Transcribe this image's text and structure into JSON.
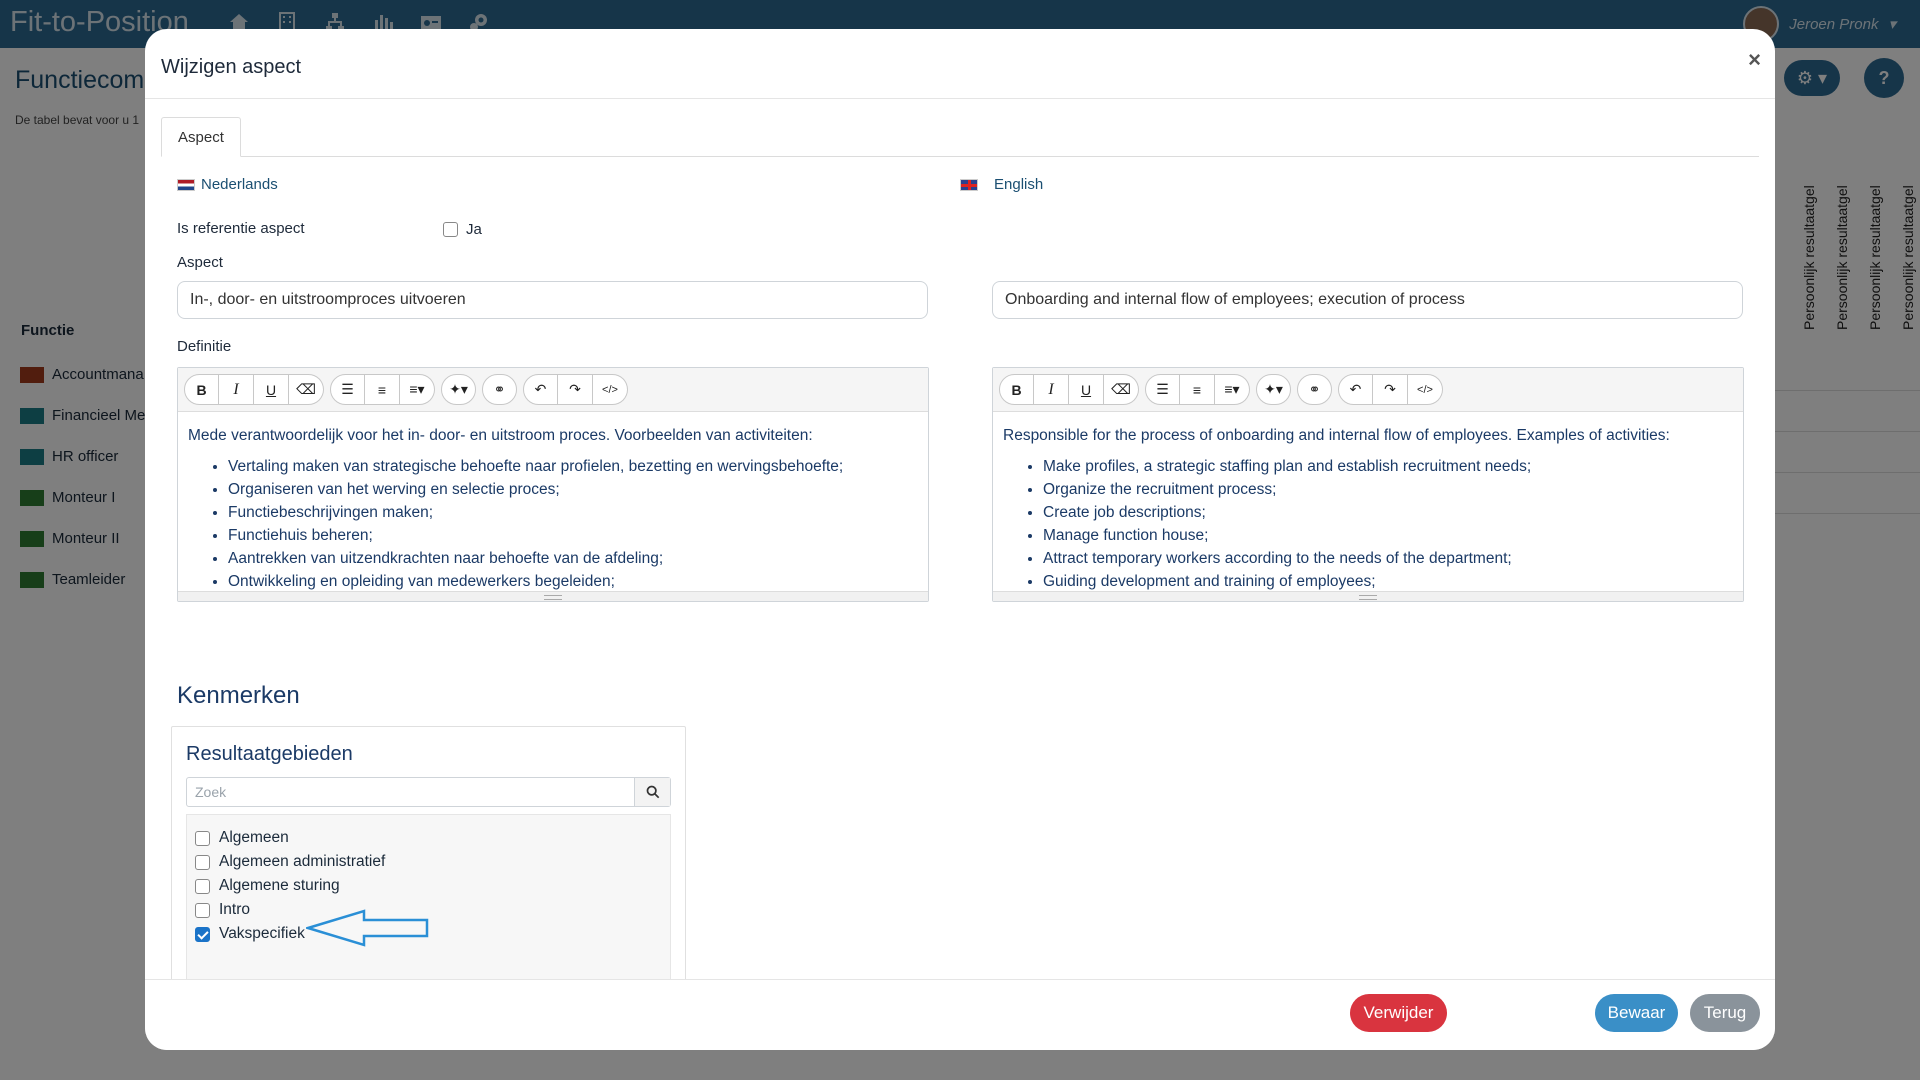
{
  "app": {
    "brand": "Fit-to-Position",
    "user_name": "Jeroen Pronk",
    "page_title": "Functiecom",
    "page_subtitle": "De tabel bevat voor u 1",
    "functie_label": "Functie",
    "functies": [
      {
        "label": "Accountmana",
        "color": "#a33a1c"
      },
      {
        "label": "Financieel Me",
        "color": "#1a7d86"
      },
      {
        "label": "HR officer",
        "color": "#1a7d86"
      },
      {
        "label": "Monteur I",
        "color": "#2e7d32"
      },
      {
        "label": "Monteur II",
        "color": "#2e7d32"
      },
      {
        "label": "Teamleider",
        "color": "#2e7d32"
      }
    ],
    "column_headers": [
      "Persoonlijk resultaatgel",
      "Persoonlijk resultaatgel",
      "Persoonlijk resultaatgel",
      "Persoonlijk resultaatgel"
    ]
  },
  "modal": {
    "title": "Wijzigen aspect",
    "close": "×",
    "tab": "Aspect",
    "lang_nl": "Nederlands",
    "lang_en": "English",
    "ref_label": "Is referentie aspect",
    "ref_checkbox_label": "Ja",
    "aspect_label": "Aspect",
    "aspect_nl": "In-, door- en uitstroomproces uitvoeren",
    "aspect_en": "Onboarding and internal flow of employees; execution of process",
    "definitie_label": "Definitie",
    "editor_nl": {
      "intro": "Mede verantwoordelijk voor het in- door- en uitstroom proces. Voorbeelden van activiteiten:",
      "items": [
        "Vertaling maken van strategische behoefte naar profielen, bezetting en wervingsbehoefte;",
        "Organiseren van het werving en selectie proces;",
        "Functiebeschrijvingen maken;",
        "Functiehuis beheren;",
        "Aantrekken van uitzendkrachten naar behoefte van de afdeling;",
        "Ontwikkeling en opleiding van medewerkers begeleiden;"
      ]
    },
    "editor_en": {
      "intro": "Responsible for the process of onboarding and internal flow of employees. Examples of activities:",
      "items": [
        "Make profiles, a strategic staffing plan and establish recruitment needs;",
        "Organize the recruitment process;",
        "Create job descriptions;",
        "Manage function house;",
        "Attract temporary workers according to the needs of the department;",
        "Guiding development and training of employees;"
      ]
    },
    "kenmerken_title": "Kenmerken",
    "resultaat_title": "Resultaatgebieden",
    "search_placeholder": "Zoek",
    "resultaatgebieden": [
      {
        "label": "Algemeen",
        "checked": false
      },
      {
        "label": "Algemeen administratief",
        "checked": false
      },
      {
        "label": "Algemene sturing",
        "checked": false
      },
      {
        "label": "Intro",
        "checked": false
      },
      {
        "label": "Vakspecifiek",
        "checked": true
      }
    ],
    "btn_delete": "Verwijder",
    "btn_save": "Bewaar",
    "btn_back": "Terug"
  },
  "colors": {
    "navbar": "#2c6a93",
    "delete": "#d9343f",
    "save": "#3a8fc7",
    "back": "#8a939b",
    "arrow": "#2a8fd6"
  }
}
